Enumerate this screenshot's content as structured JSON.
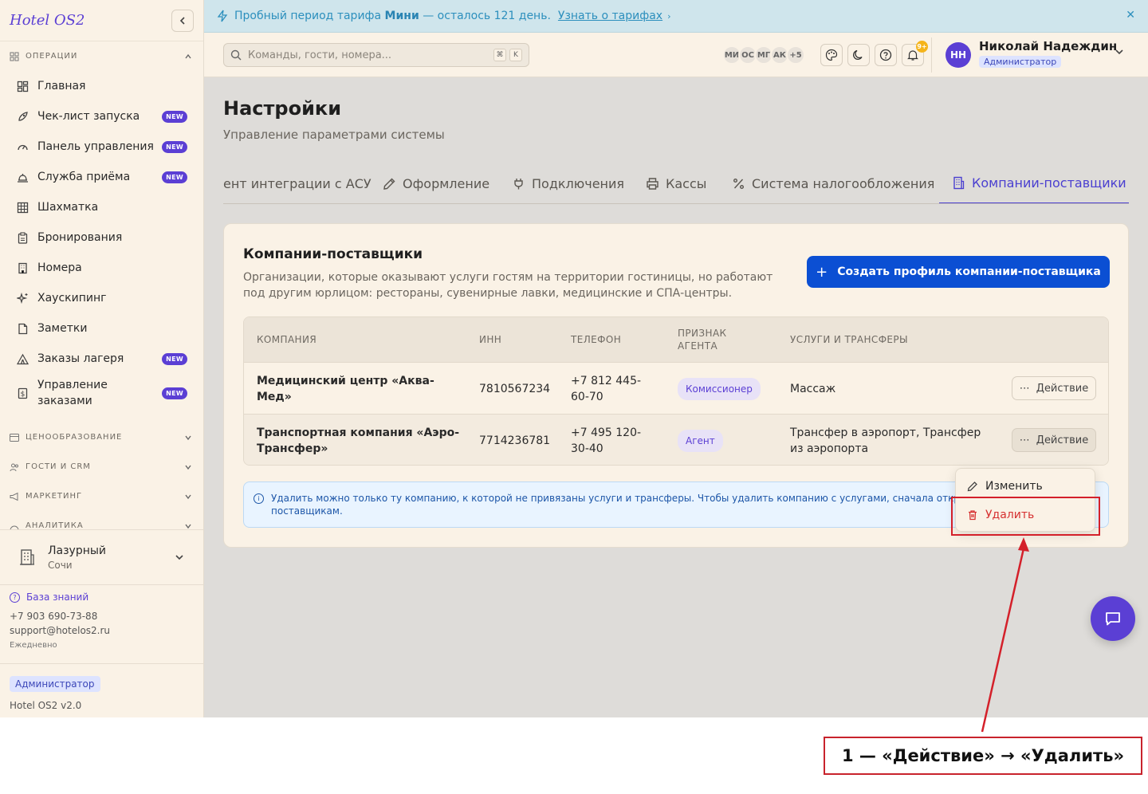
{
  "sidebar": {
    "logo": "Hotel OS2",
    "sections": {
      "operations": "ОПЕРАЦИИ",
      "pricing": "ЦЕНООБРАЗОВАНИЕ",
      "guests": "ГОСТИ И CRM",
      "marketing": "МАРКЕТИНГ",
      "analytics": "АНАЛИТИКА"
    },
    "items": [
      {
        "label": "Главная",
        "icon": "dashboard-icon"
      },
      {
        "label": "Чек-лист запуска",
        "icon": "rocket-icon",
        "badge": "NEW"
      },
      {
        "label": "Панель управления",
        "icon": "gauge-icon",
        "badge": "NEW"
      },
      {
        "label": "Служба приёма",
        "icon": "bell-icon",
        "badge": "NEW"
      },
      {
        "label": "Шахматка",
        "icon": "grid-icon"
      },
      {
        "label": "Бронирования",
        "icon": "clipboard-icon"
      },
      {
        "label": "Номера",
        "icon": "building-icon"
      },
      {
        "label": "Хаускипинг",
        "icon": "sparkles-icon"
      },
      {
        "label": "Заметки",
        "icon": "note-icon"
      },
      {
        "label": "Заказы лагеря",
        "icon": "tent-icon",
        "badge": "NEW"
      },
      {
        "label": "Управление заказами",
        "icon": "dollar-doc-icon",
        "badge": "NEW"
      }
    ],
    "hotel": {
      "name": "Лазурный",
      "city": "Сочи"
    },
    "help": {
      "kb": "База знаний",
      "phone": "+7 903 690-73-88",
      "email": "support@hotelos2.ru",
      "hours": "Ежедневно"
    },
    "footer": {
      "role": "Администратор",
      "version": "Hotel OS2 v2.0"
    }
  },
  "banner": {
    "prefix": "Пробный период тарифа",
    "plan": "Мини",
    "suffix": "— осталось 121 день.",
    "link": "Узнать о тарифах"
  },
  "header": {
    "search_placeholder": "Команды, гости, номера...",
    "key1": "⌘",
    "key2": "K",
    "avatars": [
      "МИ",
      "ОС",
      "МГ",
      "АК",
      "+5"
    ],
    "notif_count": "9+",
    "user_initials": "НН",
    "user_name": "Николай Надеждин",
    "user_role": "Администратор"
  },
  "page": {
    "title": "Настройки",
    "subtitle": "Управление параметрами системы"
  },
  "tabs": [
    {
      "label": "ент интеграции с АСУ"
    },
    {
      "label": "Оформление",
      "icon": "pencil-icon"
    },
    {
      "label": "Подключения",
      "icon": "plug-icon"
    },
    {
      "label": "Кассы",
      "icon": "printer-icon"
    },
    {
      "label": "Система налогообложения",
      "icon": "percent-icon"
    },
    {
      "label": "Компании-поставщики",
      "icon": "building-icon",
      "active": true
    }
  ],
  "card": {
    "title": "Компании-поставщики",
    "desc": "Организации, которые оказывают услуги гостям на территории гостиницы, но работают под другим юрлицом: рестораны, сувенирные лавки, медицинские и СПА-центры.",
    "create_btn": "Создать профиль компании-поставщика"
  },
  "table": {
    "columns": [
      "КОМПАНИЯ",
      "ИНН",
      "ТЕЛЕФОН",
      "ПРИЗНАК АГЕНТА",
      "УСЛУГИ И ТРАНСФЕРЫ"
    ],
    "rows": [
      {
        "company": "Медицинский центр «Аква-Мед»",
        "inn": "7810567234",
        "phone": "+7 812 445-60-70",
        "agent": "Комиссионер",
        "services": "Массаж",
        "action": "Действие"
      },
      {
        "company": "Транспортная компания «Аэро-Трансфер»",
        "inn": "7714236781",
        "phone": "+7 495 120-30-40",
        "agent": "Агент",
        "services": "Трансфер в аэропорт, Трансфер из аэропорта",
        "action": "Действие"
      }
    ]
  },
  "info": "Удалить можно только ту компанию, к которой не привязаны услуги и трансферы. Чтобы удалить компанию с услугами, сначала откройте раз услуги к другим поставщикам.",
  "dropdown": {
    "edit": "Изменить",
    "delete": "Удалить"
  },
  "annotation": {
    "label": "1 — «Действие» → «Удалить»",
    "color": "#d4202a"
  },
  "colors": {
    "accent": "#5b3fd4",
    "primary_button": "#0b4fd3",
    "danger": "#d63030"
  }
}
